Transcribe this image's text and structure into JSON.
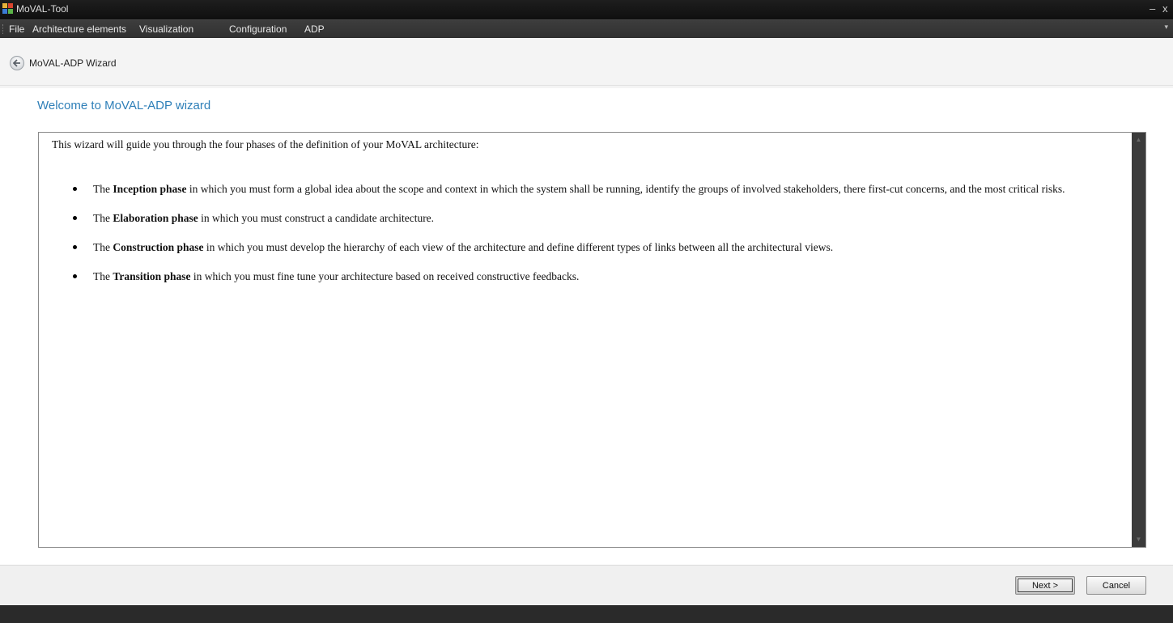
{
  "window": {
    "title": "MoVAL-Tool",
    "minimize_glyph": "–",
    "close_glyph": "x",
    "icon": "app-icon"
  },
  "menu": {
    "items": [
      "File",
      "Architecture elements",
      "Visualization",
      "Configuration",
      "ADP"
    ],
    "overflow_glyph": "▾"
  },
  "wizard": {
    "header_title": "MoVAL-ADP Wizard",
    "back_icon": "back-arrow-icon",
    "heading": "Welcome to MoVAL-ADP wizard",
    "intro": "This wizard will guide you through the four phases of the definition of your MoVAL architecture:",
    "phases": [
      {
        "prefix": "The ",
        "name": "Inception phase",
        "text": " in which you must form a global idea about the scope and context in which the system shall be running, identify the groups of involved stakeholders, there first-cut concerns, and the most critical risks."
      },
      {
        "prefix": "The ",
        "name": "Elaboration phase",
        "text": " in which you must construct a candidate architecture."
      },
      {
        "prefix": "The ",
        "name": "Construction phase",
        "text": " in which you must develop the hierarchy of each view of the architecture and define different types of links between all the architectural views."
      },
      {
        "prefix": "The ",
        "name": "Transition phase",
        "text": " in which you must fine tune your architecture based on received constructive feedbacks."
      }
    ]
  },
  "footer": {
    "next_label": "Next >",
    "cancel_label": "Cancel"
  },
  "colors": {
    "heading": "#2e7fb8",
    "titlebar": "#151515",
    "menubar": "#353535"
  }
}
